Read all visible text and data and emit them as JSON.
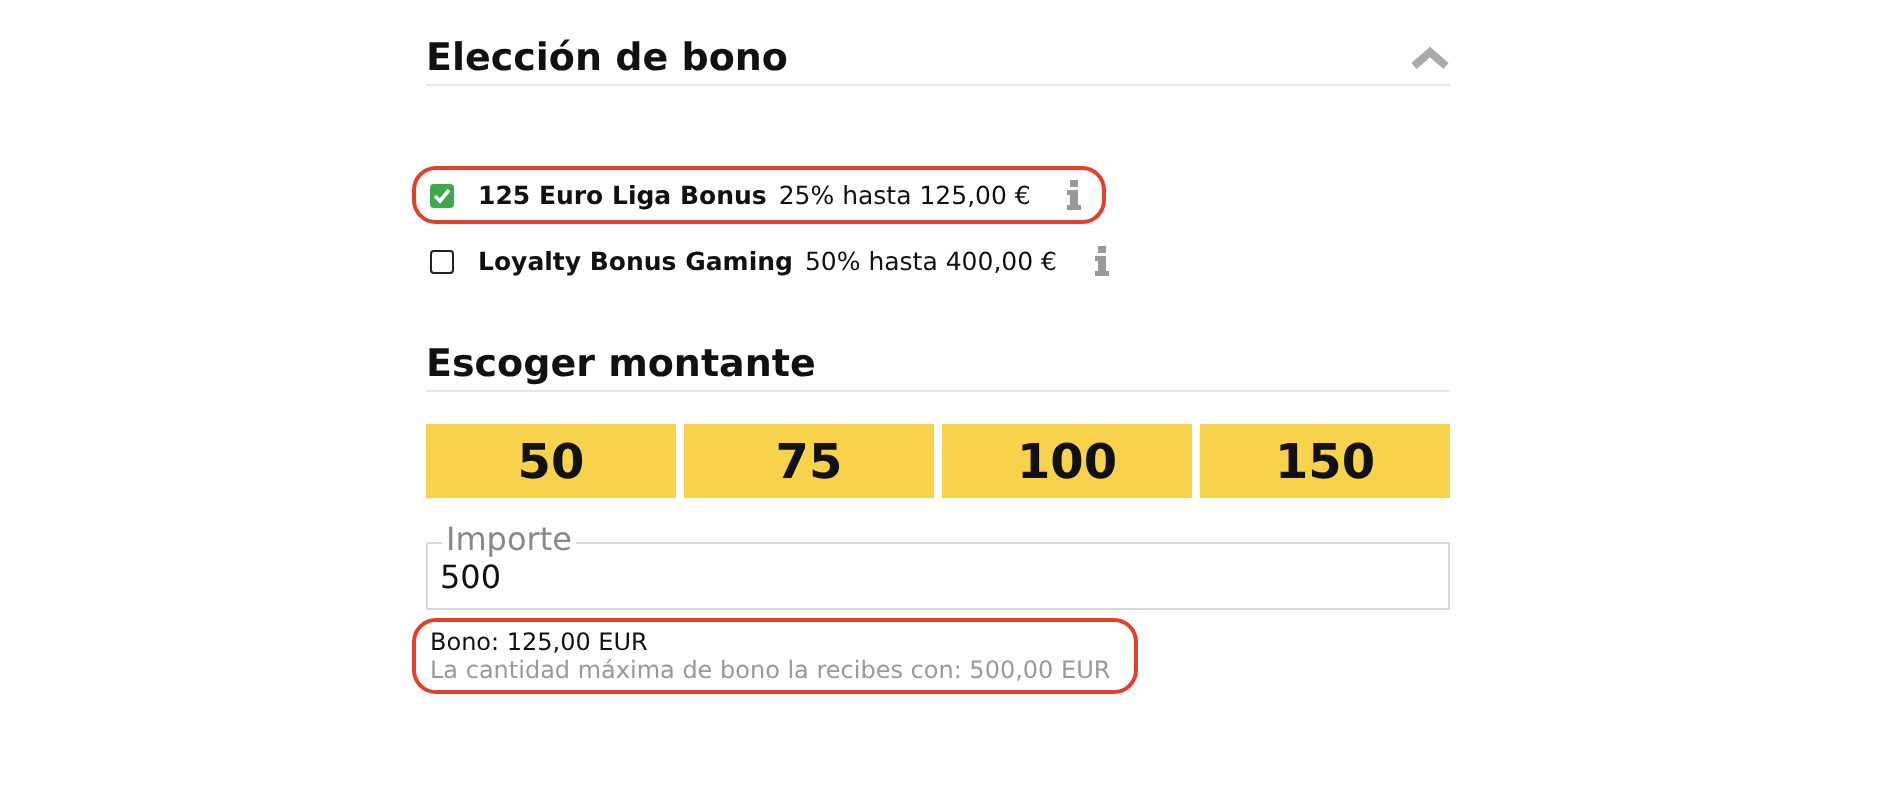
{
  "bonus_section": {
    "title": "Elección de bono",
    "expanded": true,
    "options": [
      {
        "name": "125 Euro Liga Bonus",
        "detail": "25% hasta 125,00 €",
        "checked": true,
        "highlighted": true
      },
      {
        "name": "Loyalty Bonus Gaming",
        "detail": "50% hasta 400,00 €",
        "checked": false,
        "highlighted": false
      }
    ]
  },
  "amount_section": {
    "title": "Escoger montante",
    "amounts": [
      "50",
      "75",
      "100",
      "150"
    ],
    "field": {
      "label": "Importe",
      "value": "500"
    },
    "summary": {
      "bonus": "Bono: 125,00 EUR",
      "hint": "La cantidad máxima de bono la recibes con: 500,00 EUR",
      "highlighted": true
    }
  }
}
